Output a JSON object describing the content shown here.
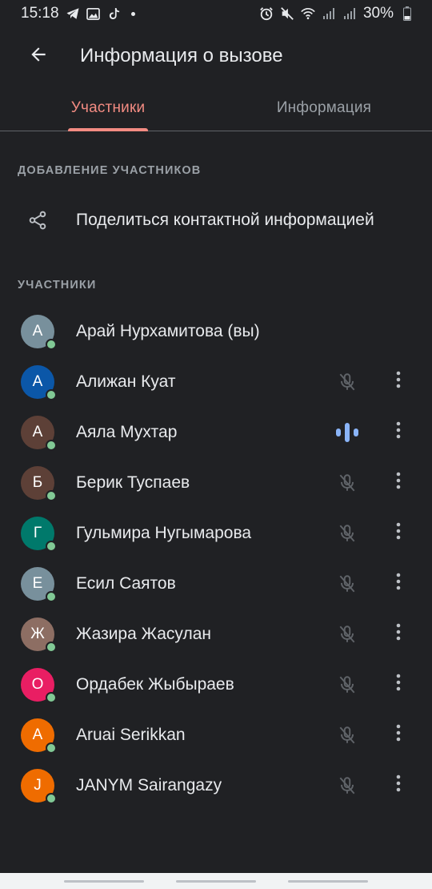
{
  "status_bar": {
    "time": "15:18",
    "battery": "30%",
    "left_icons": [
      "telegram-icon",
      "gallery-icon",
      "tiktok-icon",
      "dot-icon"
    ],
    "right_icons": [
      "alarm-icon",
      "mute-icon",
      "wifi-icon",
      "signal-icon",
      "signal-icon",
      "battery-icon"
    ]
  },
  "app_bar": {
    "title": "Информация о вызове",
    "back_icon": "arrow-back-icon"
  },
  "tabs": [
    {
      "label": "Участники",
      "active": true
    },
    {
      "label": "Информация",
      "active": false
    }
  ],
  "add_section": {
    "header": "ДОБАВЛЕНИЕ УЧАСТНИКОВ",
    "share_label": "Поделиться контактной информацией",
    "share_icon": "share-icon"
  },
  "participants_section": {
    "header": "УЧАСТНИКИ",
    "items": [
      {
        "initial": "А",
        "name": "Арай Нурхамитова (вы)",
        "color": "#78909c",
        "mic": "none",
        "menu": false
      },
      {
        "initial": "А",
        "name": "Алижан Куат",
        "color": "#0b57a8",
        "mic": "muted",
        "menu": true
      },
      {
        "initial": "А",
        "name": "Аяла Мухтар",
        "color": "#5d4037",
        "mic": "speaking",
        "menu": true
      },
      {
        "initial": "Б",
        "name": "Берик Туспаев",
        "color": "#5d4037",
        "mic": "muted",
        "menu": true
      },
      {
        "initial": "Г",
        "name": "Гульмира Нугымарова",
        "color": "#00796b",
        "mic": "muted",
        "menu": true
      },
      {
        "initial": "Е",
        "name": "Есил Саятов",
        "color": "#78909c",
        "mic": "muted",
        "menu": true
      },
      {
        "initial": "Ж",
        "name": "Жазира Жасулан",
        "color": "#8d6e63",
        "mic": "muted",
        "menu": true
      },
      {
        "initial": "О",
        "name": "Ордабек Жыбыраев",
        "color": "#e91e63",
        "mic": "muted",
        "menu": true
      },
      {
        "initial": "A",
        "name": "Aruai Serikkan",
        "color": "#ef6c00",
        "mic": "muted",
        "menu": true
      },
      {
        "initial": "J",
        "name": "JANYM Sairangazy",
        "color": "#ef6c00",
        "mic": "muted",
        "menu": true
      }
    ]
  },
  "colors": {
    "background": "#202124",
    "accent": "#f28b82",
    "speaking": "#8ab4f8",
    "presence": "#81c995"
  }
}
